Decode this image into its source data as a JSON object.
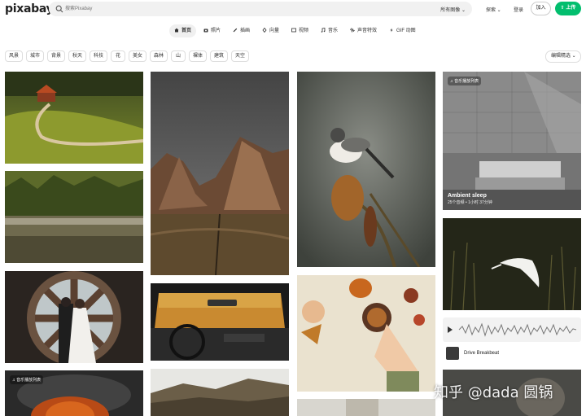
{
  "header": {
    "logo": "pixabay",
    "search_placeholder": "搜索Pixabay",
    "filter_label": "所有图像 ⌄",
    "explore_label": "探索 ⌄",
    "login_label": "登录",
    "join_label": "加入",
    "upload_label": "⇧ 上传"
  },
  "tabs": [
    {
      "label": "首页",
      "icon": "home-icon"
    },
    {
      "label": "照片",
      "icon": "camera-icon"
    },
    {
      "label": "插画",
      "icon": "brush-icon"
    },
    {
      "label": "向量",
      "icon": "pen-icon"
    },
    {
      "label": "视频",
      "icon": "film-icon"
    },
    {
      "label": "音乐",
      "icon": "music-icon"
    },
    {
      "label": "声音特效",
      "icon": "waveform-icon"
    },
    {
      "label": "GIF 动图",
      "icon": "gif-icon"
    }
  ],
  "chips": [
    "风景",
    "城市",
    "背景",
    "秋天",
    "科技",
    "花",
    "美女",
    "森林",
    "山",
    "裸体",
    "建筑",
    "天空"
  ],
  "sort_label": "编辑精选 ⌄",
  "playlist_top": {
    "badge": "♫ 音乐播放列表",
    "title": "Ambient sleep",
    "meta": "25个音频 • 1小时 37分钟"
  },
  "playlist_bottom": {
    "badge": "♫ 音乐播放列表"
  },
  "audio_track": {
    "name": "Drive Breakbeat"
  },
  "watermark": "知乎 @dada 圆锅",
  "colors": {
    "accent": "#02be6e",
    "background": "#ffffff",
    "chip_border": "#dddddd"
  }
}
